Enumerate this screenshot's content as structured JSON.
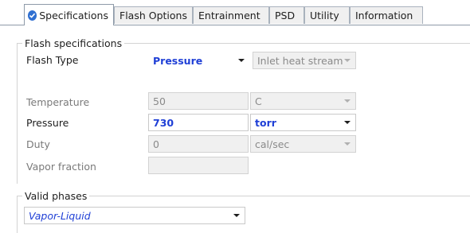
{
  "tabs": [
    {
      "label": "Specifications",
      "active": true,
      "icon": "check-circle-icon"
    },
    {
      "label": "Flash Options"
    },
    {
      "label": "Entrainment"
    },
    {
      "label": "PSD"
    },
    {
      "label": "Utility"
    },
    {
      "label": "Information"
    }
  ],
  "flash_specs": {
    "title": "Flash specifications",
    "flash_type": {
      "label": "Flash Type",
      "value": "Pressure",
      "secondary": "Inlet heat stream"
    },
    "temperature": {
      "label": "Temperature",
      "value": "50",
      "unit": "C"
    },
    "pressure": {
      "label": "Pressure",
      "value": "730",
      "unit": "torr"
    },
    "duty": {
      "label": "Duty",
      "value": "0",
      "unit": "cal/sec"
    },
    "vapor_fraction": {
      "label": "Vapor fraction",
      "value": ""
    }
  },
  "valid_phases": {
    "title": "Valid phases",
    "value": "Vapor-Liquid"
  },
  "colors": {
    "accent": "#1f3fd6",
    "check": "#2f6fd1",
    "border": "#8e9aa8"
  }
}
